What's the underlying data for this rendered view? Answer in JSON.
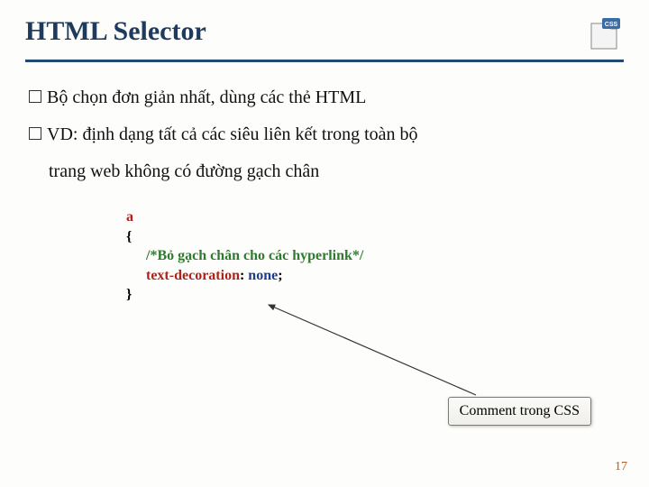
{
  "title": "HTML Selector",
  "icon": {
    "label": "CSS",
    "name": "css-file-icon"
  },
  "bullets": {
    "b1": "Bộ chọn đơn giản nhất, dùng các thẻ HTML",
    "b2": "VD: định dạng tất cả các siêu liên kết trong toàn bộ",
    "b2cont": "trang web không có đường gạch chân"
  },
  "code": {
    "selector": "a",
    "open": "{",
    "comment": "/*Bỏ gạch chân cho các hyperlink*/",
    "prop": "text-decoration",
    "colon": ": ",
    "value": "none",
    "semi": ";",
    "close": "}"
  },
  "callout": "Comment trong CSS",
  "page_number": "17"
}
